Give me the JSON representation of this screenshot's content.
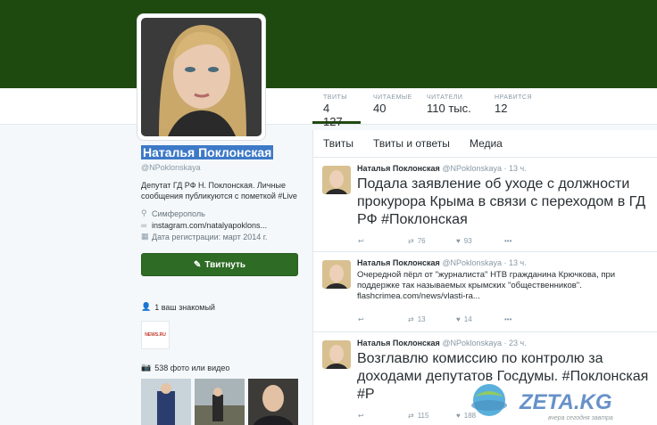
{
  "profile": {
    "name": "Наталья Поклонская",
    "handle": "@NPoklonskaya",
    "bio": "Депутат ГД РФ Н. Поклонская. Личные сообщения публикуются с пометкой #Live",
    "location": "Симферополь",
    "website": "instagram.com/natalyapoklons...",
    "joined": "Дата регистрации: март 2014 г.",
    "tweet_button": "Твитнуть",
    "known_followers": "1 ваш знакомый",
    "photos": "538 фото или видео",
    "known_logo": "NEWS.RU"
  },
  "stats": [
    {
      "label": "ТВИТЫ",
      "value": "4 127"
    },
    {
      "label": "ЧИТАЕМЫЕ",
      "value": "40"
    },
    {
      "label": "ЧИТАТЕЛИ",
      "value": "110 тыс."
    },
    {
      "label": "НРАВИТСЯ",
      "value": "12"
    }
  ],
  "tabs": [
    "Твиты",
    "Твиты и ответы",
    "Медиа"
  ],
  "tweets": [
    {
      "name": "Наталья Поклонская",
      "meta": "@NPoklonskaya · 13 ч.",
      "text": "Подала заявление об уходе с должности прокурора Крыма в связи с переходом в ГД РФ #Поклонская",
      "retweets": "76",
      "likes": "93"
    },
    {
      "name": "Наталья Поклонская",
      "meta": "@NPoklonskaya · 13 ч.",
      "text": "Очередной пёрл от \"журналиста\" НТВ гражданина Крючкова, при поддержке так называемых крымских \"общественников\". flashcrimea.com/news/vlasti-ra...",
      "retweets": "13",
      "likes": "14"
    },
    {
      "name": "Наталья Поклонская",
      "meta": "@NPoklonskaya · 23 ч.",
      "text": "Возглавлю комиссию по контролю за доходами депутатов Госдумы. #Поклонская #Р",
      "retweets": "115",
      "likes": "188"
    }
  ],
  "watermark": {
    "text": "ZETA.KG",
    "tagline": "вчера сегодня завтра"
  },
  "colors": {
    "banner": "#1f4a0f",
    "button": "#2e6b25",
    "highlight": "#3d79c7"
  }
}
